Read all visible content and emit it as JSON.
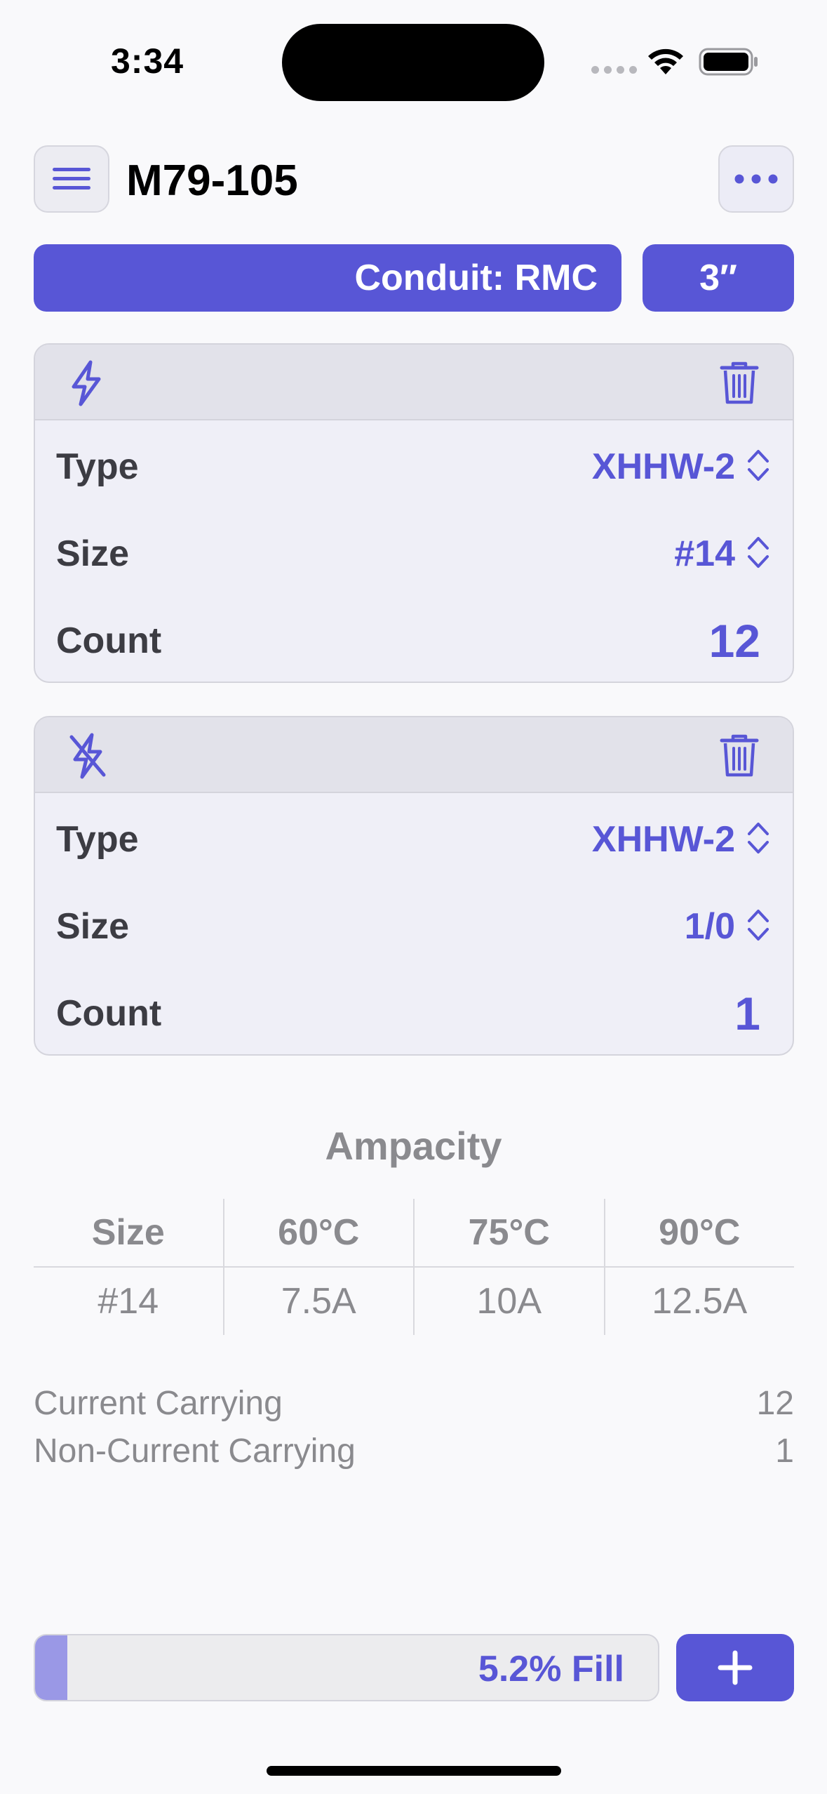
{
  "status_bar": {
    "time": "3:34"
  },
  "header": {
    "title": "M79-105"
  },
  "conduit": {
    "label": "Conduit: RMC",
    "size": "3″"
  },
  "wire_groups": [
    {
      "icon": "bolt-icon",
      "type_label": "Type",
      "type_value": "XHHW-2",
      "size_label": "Size",
      "size_value": "#14",
      "count_label": "Count",
      "count_value": "12"
    },
    {
      "icon": "bolt-slash-icon",
      "type_label": "Type",
      "type_value": "XHHW-2",
      "size_label": "Size",
      "size_value": "1/0",
      "count_label": "Count",
      "count_value": "1"
    }
  ],
  "ampacity": {
    "title": "Ampacity",
    "headers": [
      "Size",
      "60°C",
      "75°C",
      "90°C"
    ],
    "values": [
      "#14",
      "7.5A",
      "10A",
      "12.5A"
    ]
  },
  "summary": {
    "current_carrying_label": "Current Carrying",
    "current_carrying_value": "12",
    "non_current_carrying_label": "Non-Current Carrying",
    "non_current_carrying_value": "1"
  },
  "fill": {
    "label": "5.2% Fill",
    "percent": 5.2
  },
  "colors": {
    "accent": "#5856d6",
    "fill_light": "#9a98e6",
    "secondary_text": "#8a8a8e"
  }
}
